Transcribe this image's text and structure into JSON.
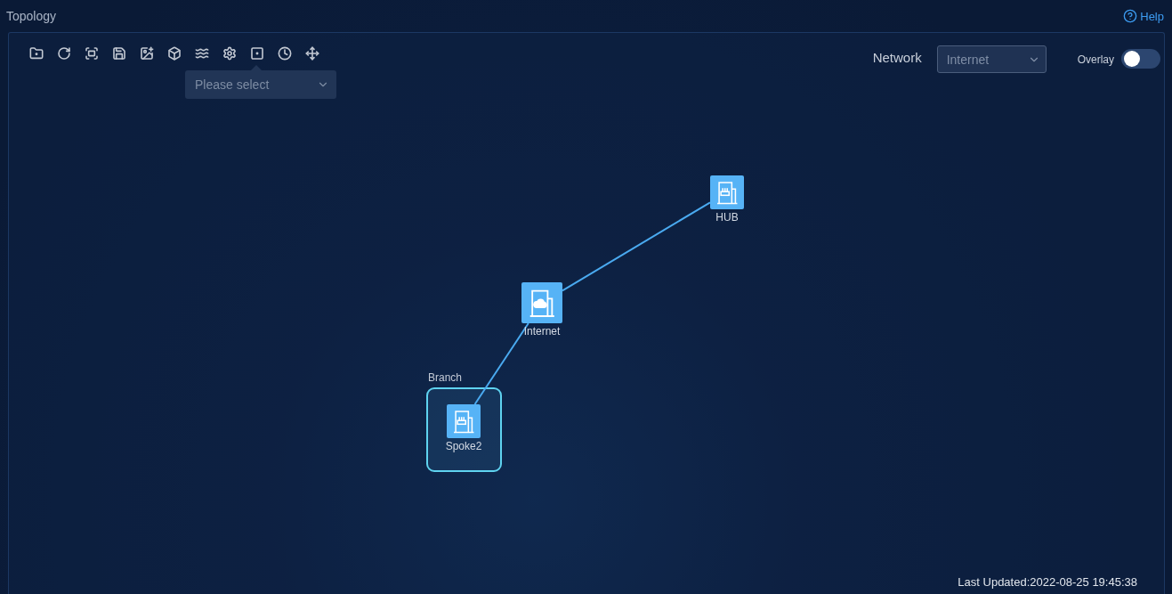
{
  "title": "Topology",
  "help": "Help",
  "toolbar": {
    "select": {
      "placeholder": "Please select"
    }
  },
  "network": {
    "label": "Network",
    "value": "Internet"
  },
  "overlay": {
    "label": "Overlay",
    "on": false
  },
  "groups": [
    {
      "label": "Branch"
    }
  ],
  "nodes": [
    {
      "label": "HUB",
      "kind": "router"
    },
    {
      "label": "Internet",
      "kind": "cloud"
    },
    {
      "label": "Spoke2",
      "kind": "router"
    }
  ],
  "status": "Last Updated:2022-08-25 19:45:38"
}
